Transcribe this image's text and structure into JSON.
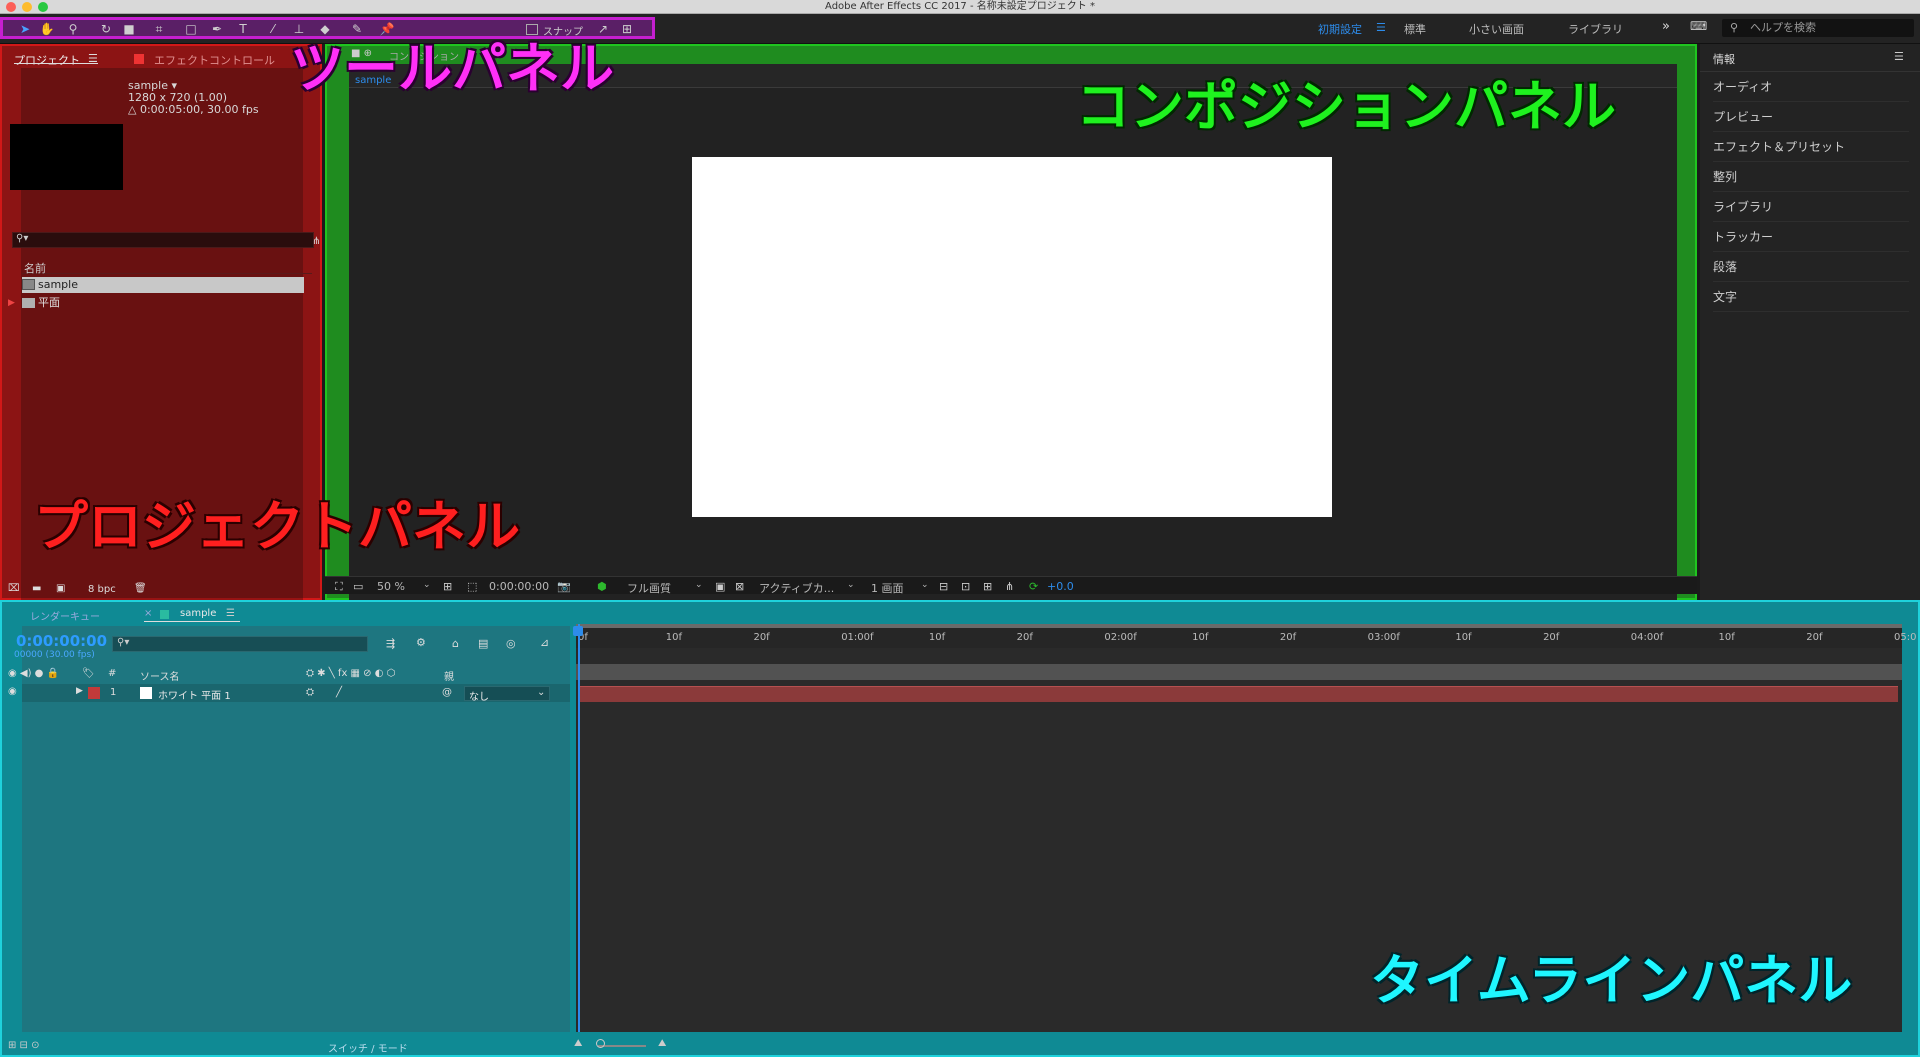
{
  "window": {
    "title": "Adobe After Effects CC 2017 - 名称未設定プロジェクト *"
  },
  "workspaces": {
    "items": [
      "初期設定",
      "標準",
      "小さい画面",
      "ライブラリ"
    ],
    "active": "初期設定",
    "more": "»",
    "help_placeholder": "ヘルプを検索"
  },
  "tools": {
    "snap_label": "スナップ"
  },
  "project": {
    "tab_project": "プロジェクト",
    "tab_effects": "エフェクトコントロール",
    "item_name": "sample ▾",
    "item_res": "1280 x 720 (1.00)",
    "item_dur": "△ 0:00:05:00, 30.00 fps",
    "col_name": "名前",
    "rows": [
      {
        "name": "sample"
      },
      {
        "name": "平面"
      }
    ],
    "bpc": "8 bpc"
  },
  "composition": {
    "tab": "コンポジション",
    "comp_tab": "sample",
    "zoom": "50 %",
    "time": "0:00:00:00",
    "quality": "フル画質",
    "camera": "アクティブカ...",
    "views": "1 画面",
    "exposure": "+0.0"
  },
  "right_panel": {
    "title": "情報",
    "items": [
      "オーディオ",
      "プレビュー",
      "エフェクト＆プリセット",
      "整列",
      "ライブラリ",
      "トラッカー",
      "段落",
      "文字"
    ]
  },
  "timeline": {
    "tab_render": "レンダーキュー",
    "tab_comp": "sample",
    "timecode": "0:00:00:00",
    "frames": "00000 (30.00 fps)",
    "col_num": "#",
    "col_source": "ソース名",
    "col_parent": "親",
    "layer": {
      "num": "1",
      "name": "ホワイト 平面 1",
      "parent": "なし"
    },
    "ruler": [
      "0f",
      "10f",
      "20f",
      "01:00f",
      "10f",
      "20f",
      "02:00f",
      "10f",
      "20f",
      "03:00f",
      "10f",
      "20f",
      "04:00f",
      "10f",
      "20f",
      "05:0"
    ],
    "switch_mode": "スイッチ / モード"
  },
  "annotations": {
    "tool_panel": "ツールパネル",
    "comp_panel": "コンポジションパネル",
    "project_panel": "プロジェクトパネル",
    "timeline_panel": "タイムラインパネル"
  },
  "colors": {
    "tool_accent": "#c51fd0",
    "comp_accent": "#1fc51f",
    "project_accent": "#d11818",
    "timeline_accent": "#1fd2dc",
    "ae_blue": "#2d8ceb"
  }
}
